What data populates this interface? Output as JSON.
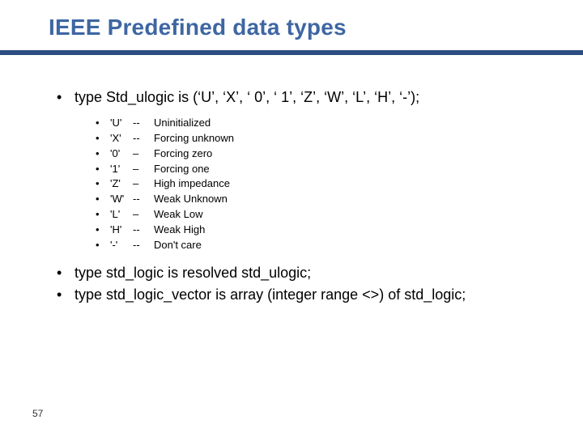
{
  "title": "IEEE Predefined data types",
  "bullets": {
    "main1": "type Std_ulogic is (‘U’, ‘X’, ‘ 0’, ‘ 1’, ‘Z’, ‘W’, ‘L’, ‘H’, ‘-’);",
    "sub": [
      {
        "code": "'U'",
        "sep": "--",
        "desc": "Uninitialized"
      },
      {
        "code": "'X'",
        "sep": "--",
        "desc": "Forcing unknown"
      },
      {
        "code": "'0'",
        "sep": "–",
        "desc": "Forcing zero"
      },
      {
        "code": "'1'",
        "sep": "–",
        "desc": "Forcing one"
      },
      {
        "code": "'Z'",
        "sep": "–",
        "desc": "High impedance"
      },
      {
        "code": "'W'",
        "sep": "--",
        "desc": "Weak Unknown"
      },
      {
        "code": "'L'",
        "sep": "–",
        "desc": "Weak Low"
      },
      {
        "code": "'H'",
        "sep": "--",
        "desc": " Weak High"
      },
      {
        "code": "'-'",
        "sep": "--",
        "desc": "Don't care"
      }
    ],
    "main2": "type std_logic is resolved std_ulogic;",
    "main3": "type std_logic_vector is array (integer range <>) of std_logic;"
  },
  "page_number": "57",
  "bullet_char": "•"
}
